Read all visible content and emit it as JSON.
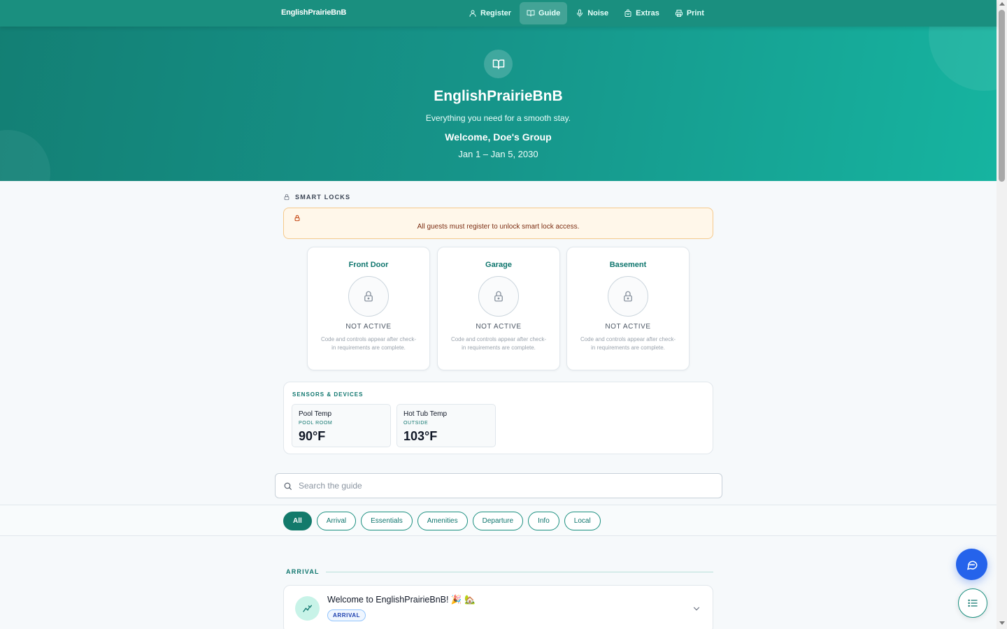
{
  "brand": "EnglishPrairieBnB",
  "nav": [
    {
      "label": "Register",
      "icon": "user-icon"
    },
    {
      "label": "Guide",
      "icon": "book-icon",
      "active": true
    },
    {
      "label": "Noise",
      "icon": "microphone-icon"
    },
    {
      "label": "Extras",
      "icon": "bag-icon"
    },
    {
      "label": "Print",
      "icon": "printer-icon"
    }
  ],
  "hero": {
    "title": "EnglishPrairieBnB",
    "subtitle": "Everything you need for a smooth stay.",
    "welcome": "Welcome, Doe's Group",
    "dates": "Jan 1 – Jan 5, 2030"
  },
  "smart_locks": {
    "heading": "SMART LOCKS",
    "alert": "All guests must register to unlock smart lock access.",
    "locks": [
      {
        "name": "Front Door",
        "status": "NOT ACTIVE",
        "note": "Code and controls appear after check-in requirements are complete."
      },
      {
        "name": "Garage",
        "status": "NOT ACTIVE",
        "note": "Code and controls appear after check-in requirements are complete."
      },
      {
        "name": "Basement",
        "status": "NOT ACTIVE",
        "note": "Code and controls appear after check-in requirements are complete."
      }
    ]
  },
  "sensors": {
    "heading": "SENSORS & DEVICES",
    "items": [
      {
        "name": "Pool Temp",
        "location": "POOL ROOM",
        "value": "90°F"
      },
      {
        "name": "Hot Tub Temp",
        "location": "OUTSIDE",
        "value": "103°F"
      }
    ]
  },
  "search": {
    "placeholder": "Search the guide",
    "value": ""
  },
  "filters": [
    {
      "label": "All",
      "active": true
    },
    {
      "label": "Arrival"
    },
    {
      "label": "Essentials"
    },
    {
      "label": "Amenities"
    },
    {
      "label": "Departure"
    },
    {
      "label": "Info"
    },
    {
      "label": "Local"
    }
  ],
  "arrival": {
    "heading": "ARRIVAL",
    "card": {
      "title": "Welcome to EnglishPrairieBnB! 🎉 🏡",
      "badge": "ARRIVAL"
    }
  },
  "colors": {
    "accent": "#1a8f7f",
    "chat_button": "#2563eb",
    "alert_bg": "#fff7ea"
  }
}
